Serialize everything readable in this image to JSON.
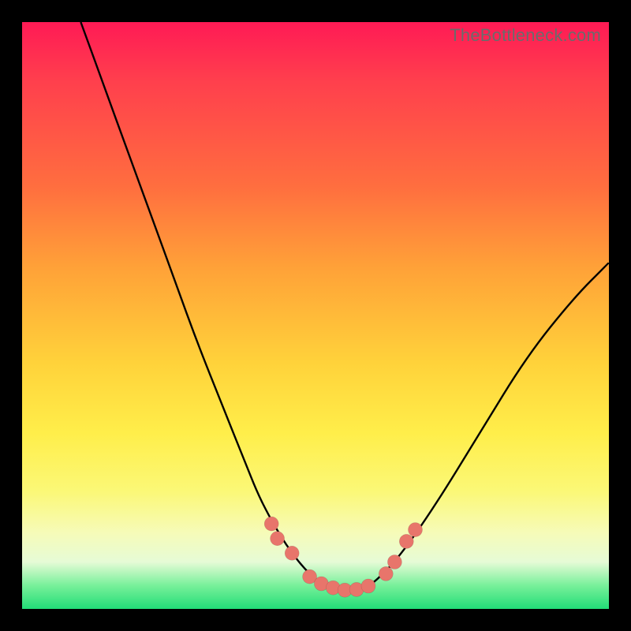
{
  "watermark": "TheBottleneck.com",
  "colors": {
    "background": "#000000",
    "gradient_top": "#ff1a55",
    "gradient_mid": "#ffd23a",
    "gradient_bottom": "#22dd77",
    "curve": "#000000",
    "dot": "#e8756b"
  },
  "chart_data": {
    "type": "line",
    "title": "",
    "xlabel": "",
    "ylabel": "",
    "xlim": [
      0,
      100
    ],
    "ylim": [
      0,
      100
    ],
    "grid": false,
    "legend": false,
    "series": [
      {
        "name": "curve",
        "x": [
          10,
          14,
          18,
          22,
          26,
          30,
          34,
          38,
          40,
          42,
          44,
          46,
          48,
          50,
          52,
          54,
          56,
          58,
          60,
          64,
          70,
          78,
          86,
          94,
          100
        ],
        "y": [
          100,
          89,
          78,
          67,
          56,
          45,
          35,
          25,
          20,
          16,
          12.5,
          9.5,
          7,
          5,
          4,
          3.3,
          3,
          3.3,
          4.5,
          8.5,
          17,
          30,
          43,
          53,
          59
        ]
      }
    ],
    "markers": [
      {
        "x": 42.5,
        "y": 14.5
      },
      {
        "x": 43.5,
        "y": 12.0
      },
      {
        "x": 46.0,
        "y": 9.5
      },
      {
        "x": 49.0,
        "y": 5.5
      },
      {
        "x": 51.0,
        "y": 4.3
      },
      {
        "x": 53.0,
        "y": 3.6
      },
      {
        "x": 55.0,
        "y": 3.2
      },
      {
        "x": 57.0,
        "y": 3.3
      },
      {
        "x": 59.0,
        "y": 3.9
      },
      {
        "x": 62.0,
        "y": 6.0
      },
      {
        "x": 63.5,
        "y": 8.0
      },
      {
        "x": 65.5,
        "y": 11.5
      },
      {
        "x": 67.0,
        "y": 13.5
      }
    ]
  }
}
